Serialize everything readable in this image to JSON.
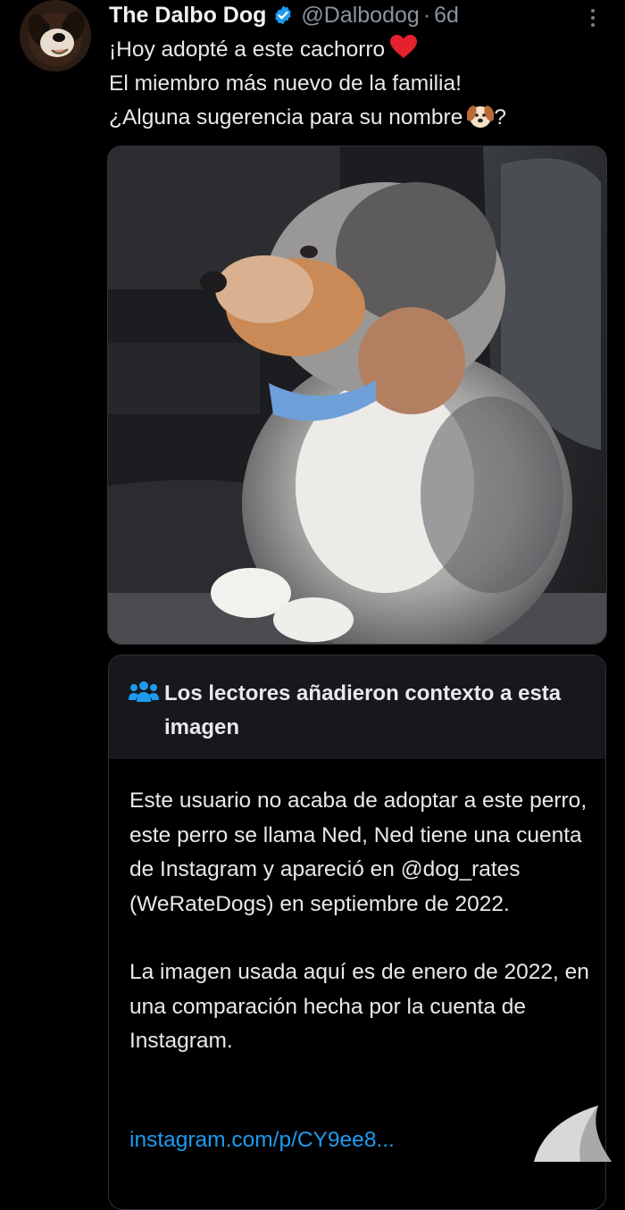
{
  "author": {
    "name": "The Dalbo Dog",
    "handle": "@Dalbodog",
    "separator": "·",
    "time": "6d",
    "verified": true
  },
  "tweet": {
    "lines": [
      "¡Hoy adopté a este cachorro",
      "El miembro más nuevo de la familia!",
      "¿Alguna sugerencia para su nombre",
      "?"
    ],
    "emojis": [
      "red-heart",
      "dog-face"
    ]
  },
  "media": {
    "description_icon": "puppy-photo"
  },
  "community_note": {
    "title": "Los lectores añadieron contexto a esta imagen",
    "paragraphs": [
      "Este usuario no acaba de adoptar a este perro, este perro se llama Ned, Ned tiene una cuenta de Instagram y apareció en @dog_rates (WeRateDogs) en septiembre de 2022.",
      "La imagen usada aquí es de enero de 2022, en una comparación hecha por la cuenta de Instagram."
    ],
    "link": "instagram.com/p/CY9ee8..."
  },
  "colors": {
    "background": "#000000",
    "link": "#1d9bf0",
    "verified": "#1d9bf0",
    "muted": "#8b949b",
    "note_header": "#16181c"
  }
}
